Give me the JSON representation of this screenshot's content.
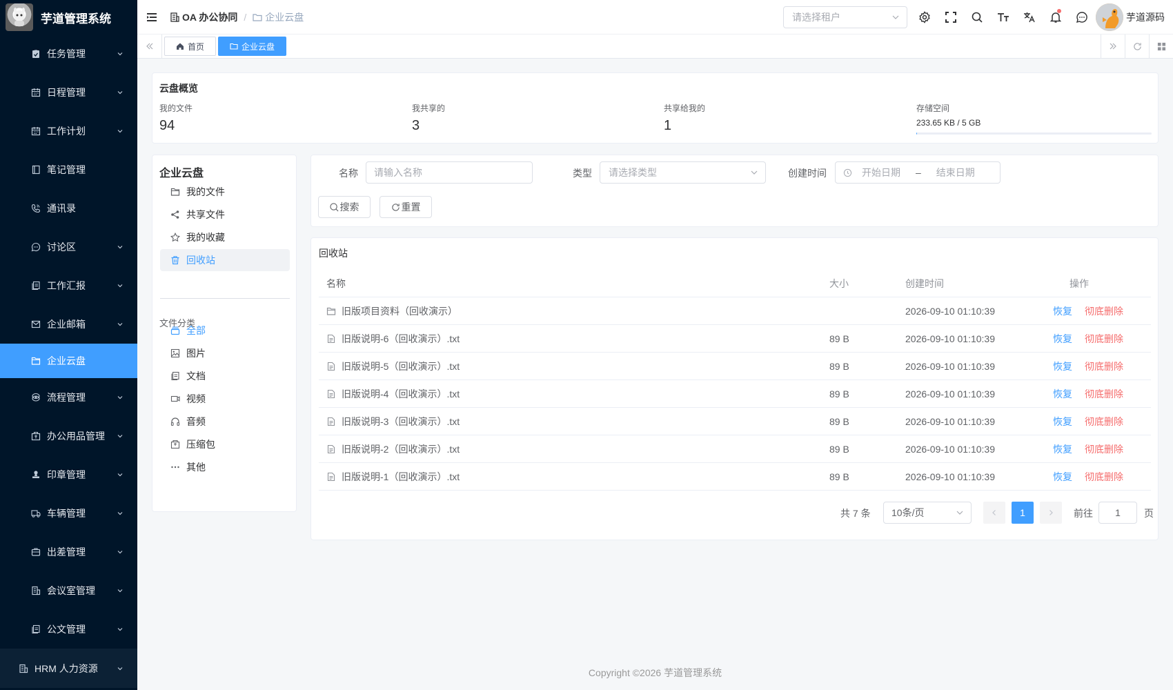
{
  "app": {
    "title": "芋道管理系统"
  },
  "sidebar": {
    "items": [
      {
        "label": "任务管理",
        "icon": "task-icon",
        "has_children": true
      },
      {
        "label": "日程管理",
        "icon": "calendar-icon",
        "has_children": true
      },
      {
        "label": "工作计划",
        "icon": "calendar-icon",
        "has_children": true
      },
      {
        "label": "笔记管理",
        "icon": "notebook-icon",
        "has_children": false
      },
      {
        "label": "通讯录",
        "icon": "phone-icon",
        "has_children": false
      },
      {
        "label": "讨论区",
        "icon": "chat-icon",
        "has_children": true
      },
      {
        "label": "工作汇报",
        "icon": "report-icon",
        "has_children": true
      },
      {
        "label": "企业邮箱",
        "icon": "mail-icon",
        "has_children": true
      },
      {
        "label": "企业云盘",
        "icon": "folder-icon",
        "has_children": false,
        "active": true
      },
      {
        "label": "流程管理",
        "icon": "flow-icon",
        "has_children": true
      },
      {
        "label": "办公用品管理",
        "icon": "box-icon",
        "has_children": true
      },
      {
        "label": "印章管理",
        "icon": "stamp-icon",
        "has_children": true
      },
      {
        "label": "车辆管理",
        "icon": "car-icon",
        "has_children": true
      },
      {
        "label": "出差管理",
        "icon": "briefcase-icon",
        "has_children": true
      },
      {
        "label": "会议室管理",
        "icon": "building-icon",
        "has_children": true
      },
      {
        "label": "公文管理",
        "icon": "document-icon",
        "has_children": true
      },
      {
        "label": "HRM 人力资源",
        "icon": "building-icon",
        "has_children": true
      }
    ]
  },
  "header": {
    "breadcrumb": [
      "OA 办公协同",
      "企业云盘"
    ],
    "tenant_placeholder": "请选择租户",
    "user_name": "芋道源码"
  },
  "tags": [
    {
      "label": "首页",
      "icon": "home-icon",
      "active": false
    },
    {
      "label": "企业云盘",
      "icon": "folder-icon",
      "active": true
    }
  ],
  "overview": {
    "title": "云盘概览",
    "stats": [
      {
        "label": "我的文件",
        "value": "94"
      },
      {
        "label": "我共享的",
        "value": "3"
      },
      {
        "label": "共享给我的",
        "value": "1"
      }
    ],
    "storage": {
      "label": "存储空间",
      "value": "233.65 KB / 5 GB",
      "used_fraction": 4e-05
    }
  },
  "leftpanel": {
    "title": "企业云盘",
    "nav": [
      {
        "label": "我的文件",
        "icon": "folder-icon"
      },
      {
        "label": "共享文件",
        "icon": "share-icon"
      },
      {
        "label": "我的收藏",
        "icon": "star-icon"
      },
      {
        "label": "回收站",
        "icon": "trash-icon",
        "active": true
      }
    ],
    "category_title": "文件分类",
    "categories": [
      {
        "label": "全部",
        "icon": "all-files-icon",
        "active": true
      },
      {
        "label": "图片",
        "icon": "image-icon"
      },
      {
        "label": "文档",
        "icon": "document-icon"
      },
      {
        "label": "视频",
        "icon": "video-icon"
      },
      {
        "label": "音频",
        "icon": "headphones-icon"
      },
      {
        "label": "压缩包",
        "icon": "archive-icon"
      },
      {
        "label": "其他",
        "icon": "more-icon"
      }
    ]
  },
  "filter": {
    "name_label": "名称",
    "name_placeholder": "请输入名称",
    "type_label": "类型",
    "type_placeholder": "请选择类型",
    "time_label": "创建时间",
    "start_placeholder": "开始日期",
    "range_sep": "–",
    "end_placeholder": "结束日期",
    "search_label": "搜索",
    "reset_label": "重置"
  },
  "table": {
    "title": "回收站",
    "columns": [
      "名称",
      "大小",
      "创建时间",
      "操作"
    ],
    "restore_label": "恢复",
    "delete_label": "彻底删除",
    "rows": [
      {
        "name": "旧版项目资料（回收演示）",
        "type": "folder",
        "size": "",
        "created": "2026-09-10 01:10:39"
      },
      {
        "name": "旧版说明-6（回收演示）.txt",
        "type": "file",
        "size": "89 B",
        "created": "2026-09-10 01:10:39"
      },
      {
        "name": "旧版说明-5（回收演示）.txt",
        "type": "file",
        "size": "89 B",
        "created": "2026-09-10 01:10:39"
      },
      {
        "name": "旧版说明-4（回收演示）.txt",
        "type": "file",
        "size": "89 B",
        "created": "2026-09-10 01:10:39"
      },
      {
        "name": "旧版说明-3（回收演示）.txt",
        "type": "file",
        "size": "89 B",
        "created": "2026-09-10 01:10:39"
      },
      {
        "name": "旧版说明-2（回收演示）.txt",
        "type": "file",
        "size": "89 B",
        "created": "2026-09-10 01:10:39"
      },
      {
        "name": "旧版说明-1（回收演示）.txt",
        "type": "file",
        "size": "89 B",
        "created": "2026-09-10 01:10:39"
      }
    ]
  },
  "pagination": {
    "total_text": "共 7 条",
    "page_size": "10条/页",
    "current_page": "1",
    "goto_label": "前往",
    "goto_value": "1",
    "page_suffix": "页"
  },
  "footer": {
    "copyright": "Copyright ©2026 芋道管理系统"
  },
  "colors": {
    "sidebar_bg": "#001529",
    "accent": "#409eff",
    "danger": "#f56c6c"
  }
}
